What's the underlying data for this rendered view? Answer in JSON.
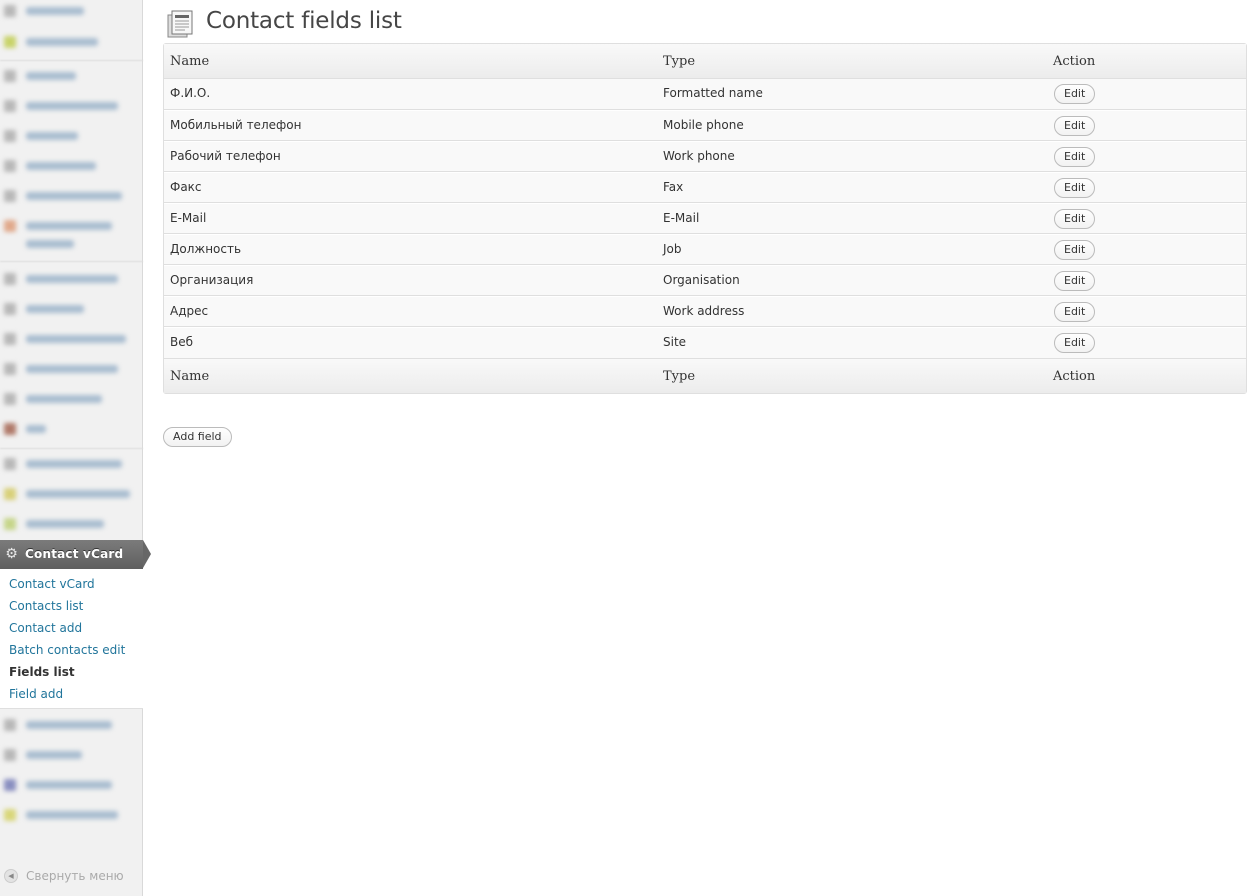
{
  "sidebar": {
    "active_menu": {
      "label": "Contact vCard",
      "icon": "gear-icon"
    },
    "submenu": [
      {
        "label": "Contact vCard",
        "current": false
      },
      {
        "label": "Contacts list",
        "current": false
      },
      {
        "label": "Contact add",
        "current": false
      },
      {
        "label": "Batch contacts edit",
        "current": false
      },
      {
        "label": "Fields list",
        "current": true
      },
      {
        "label": "Field add",
        "current": false
      }
    ],
    "collapse_label": "Свернуть меню"
  },
  "page": {
    "title": "Contact fields list",
    "icon": "document-list-icon"
  },
  "table": {
    "headers": {
      "name": "Name",
      "type": "Type",
      "action": "Action"
    },
    "rows": [
      {
        "name": "Ф.И.О.",
        "type": "Formatted name",
        "action": "Edit"
      },
      {
        "name": "Мобильный телефон",
        "type": "Mobile phone",
        "action": "Edit"
      },
      {
        "name": "Рабочий телефон",
        "type": "Work phone",
        "action": "Edit"
      },
      {
        "name": "Факс",
        "type": "Fax",
        "action": "Edit"
      },
      {
        "name": "E-Mail",
        "type": "E-Mail",
        "action": "Edit"
      },
      {
        "name": "Должность",
        "type": "Job",
        "action": "Edit"
      },
      {
        "name": "Организация",
        "type": "Organisation",
        "action": "Edit"
      },
      {
        "name": "Адрес",
        "type": "Work address",
        "action": "Edit"
      },
      {
        "name": "Веб",
        "type": "Site",
        "action": "Edit"
      }
    ]
  },
  "add_field_label": "Add field",
  "colors": {
    "link": "#21759b",
    "active_menu_bg": "#676767",
    "sidebar_bg": "#f1f1f1"
  }
}
